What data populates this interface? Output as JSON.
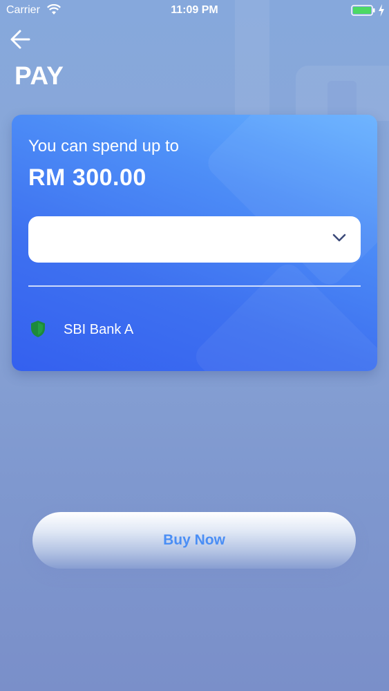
{
  "status_bar": {
    "carrier": "Carrier",
    "time": "11:09 PM"
  },
  "nav": {
    "back_icon": "arrow-left-icon"
  },
  "page": {
    "title": "PAY"
  },
  "card": {
    "label": "You can spend up to",
    "amount": "RM 300.00",
    "dropdown": {
      "selected_value": "",
      "icon": "chevron-down-icon"
    },
    "bank": {
      "name": "SBI Bank A",
      "icon": "shield-icon"
    }
  },
  "actions": {
    "buy_label": "Buy Now"
  },
  "colors": {
    "card_top": "#66b1ff",
    "card_bottom": "#3460ef",
    "button_text": "#4a8ef5",
    "shield": "#1d8a3a",
    "battery": "#4cd964"
  }
}
